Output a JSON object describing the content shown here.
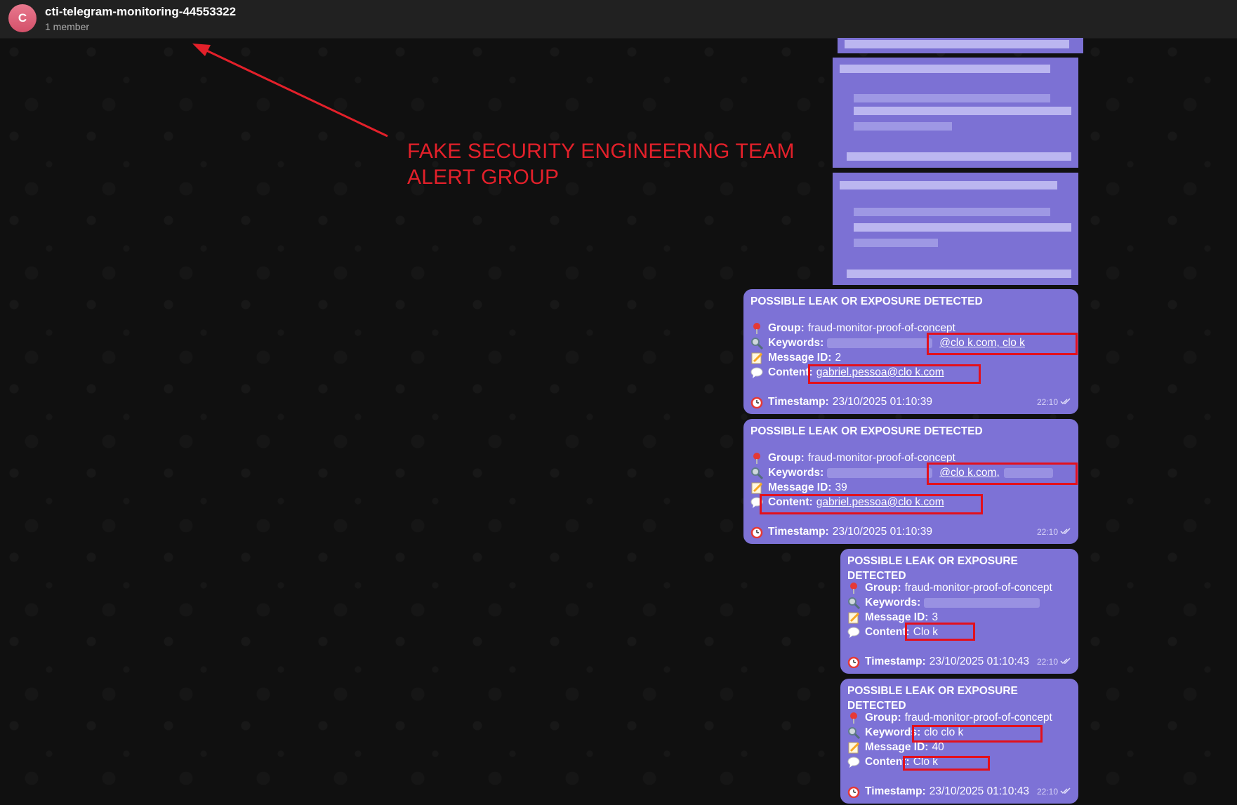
{
  "header": {
    "avatar_letter": "C",
    "title": "cti-telegram-monitoring-44553322",
    "subtitle": "1 member"
  },
  "annotation": {
    "text_line1": "FAKE SECURITY ENGINEERING TEAM",
    "text_line2": "ALERT GROUP",
    "color": "#e3202a"
  },
  "messages": [
    {
      "title": "POSSIBLE LEAK OR EXPOSURE DETECTED",
      "group_label": "Group:",
      "group": "fraud-monitor-proof-of-concept",
      "keywords_label": "Keywords:",
      "keywords_visible": "@clo       k.com, clo      k",
      "msgid_label": "Message ID:",
      "message_id": "2",
      "content_label": "Content:",
      "content": "gabriel.pessoa@clo         k.com",
      "timestamp_label": "Timestamp:",
      "timestamp": "23/10/2025 01:10:39",
      "time": "22:10"
    },
    {
      "title": "POSSIBLE LEAK OR EXPOSURE DETECTED",
      "group_label": "Group:",
      "group": "fraud-monitor-proof-of-concept",
      "keywords_label": "Keywords:",
      "keywords_visible": "@clo      k.com,",
      "msgid_label": "Message ID:",
      "message_id": "39",
      "content_label": "Content:",
      "content": "gabriel.pessoa@clo       k.com",
      "timestamp_label": "Timestamp:",
      "timestamp": "23/10/2025 01:10:39",
      "time": "22:10"
    },
    {
      "title": "POSSIBLE LEAK OR EXPOSURE DETECTED",
      "group_label": "Group:",
      "group": "fraud-monitor-proof-of-concept",
      "keywords_label": "Keywords:",
      "keywords_visible": "",
      "msgid_label": "Message ID:",
      "message_id": "3",
      "content_label": "Content:",
      "content": "Clo        k",
      "timestamp_label": "Timestamp:",
      "timestamp": "23/10/2025 01:10:43",
      "time": "22:10"
    },
    {
      "title": "POSSIBLE LEAK OR EXPOSURE DETECTED",
      "group_label": "Group:",
      "group": "fraud-monitor-proof-of-concept",
      "keywords_label": "Keywords:",
      "keywords_visible": "clo      clo        k",
      "msgid_label": "Message ID:",
      "message_id": "40",
      "content_label": "Content:",
      "content": "Clo        k",
      "timestamp_label": "Timestamp:",
      "timestamp": "23/10/2025 01:10:43",
      "time": "22:10"
    }
  ],
  "icons": {
    "group": "pushpin-icon",
    "keywords": "magnifier-icon",
    "message_id": "memo-icon",
    "content": "speech-bubble-icon",
    "timestamp": "alarm-clock-icon",
    "read": "double-check-icon"
  },
  "colors": {
    "bubble": "#7d72d6",
    "highlight_box": "#e3101c",
    "header_bg": "#212121"
  }
}
